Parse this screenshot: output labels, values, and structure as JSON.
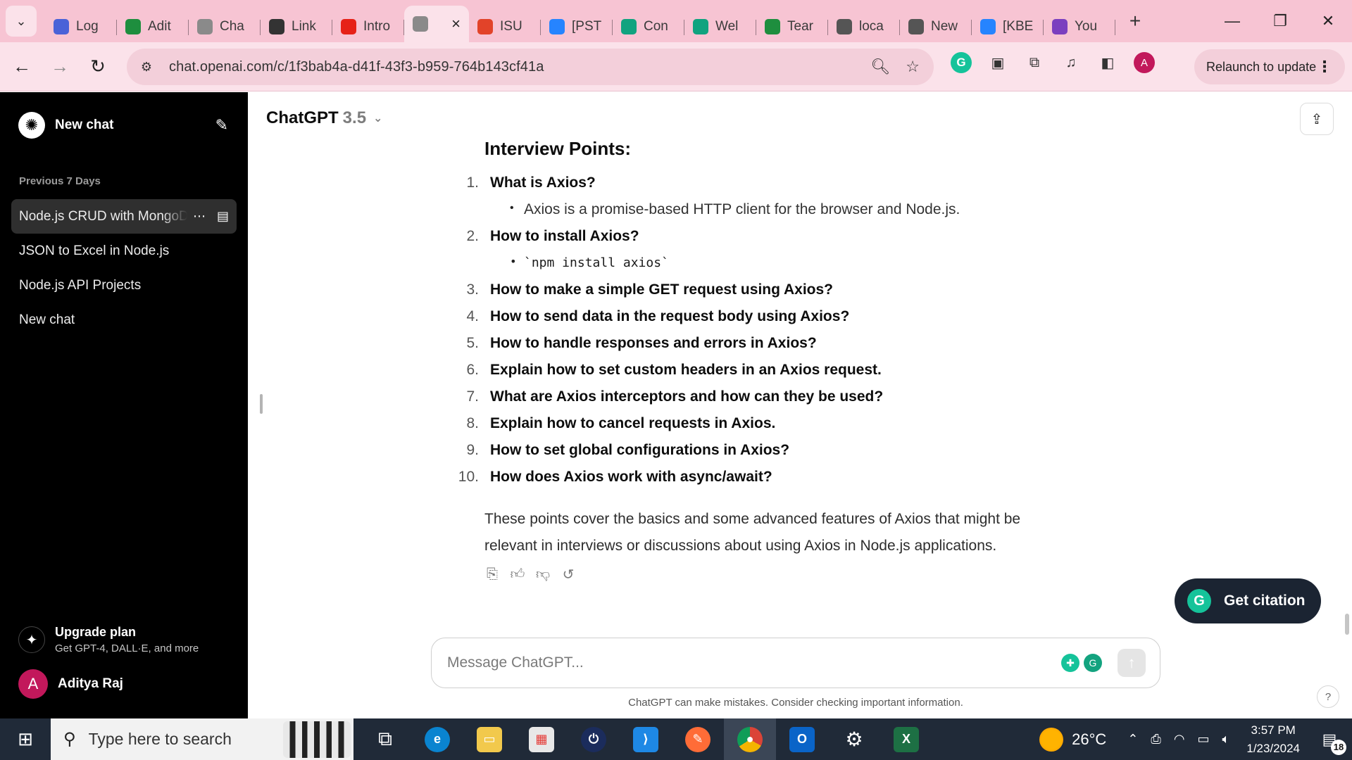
{
  "browser": {
    "tabs": [
      {
        "title": "Log",
        "icon": "powerautomate-icon",
        "color": "#4a62d8"
      },
      {
        "title": "Adit",
        "icon": "plus-square-icon",
        "color": "#1e8e3e"
      },
      {
        "title": "Cha",
        "icon": "chatgpt-icon",
        "color": "#8a8a8a"
      },
      {
        "title": "Link",
        "icon": "chevron-left-icon",
        "color": "#333333"
      },
      {
        "title": "Intro",
        "icon": "youtube-icon",
        "color": "#e62117"
      },
      {
        "title": "",
        "icon": "chatgpt-icon",
        "color": "#8a8a8a",
        "active": true
      },
      {
        "title": "ISU",
        "icon": "gitlab-icon",
        "color": "#e24329"
      },
      {
        "title": "[PST",
        "icon": "jira-icon",
        "color": "#2684ff"
      },
      {
        "title": "Con",
        "icon": "chatgpt-icon",
        "color": "#10a37f"
      },
      {
        "title": "Wel",
        "icon": "chatgpt-icon",
        "color": "#10a37f"
      },
      {
        "title": "Tear",
        "icon": "plus-square-icon",
        "color": "#1e8e3e"
      },
      {
        "title": "loca",
        "icon": "globe-icon",
        "color": "#555555"
      },
      {
        "title": "New",
        "icon": "chatgpt-icon",
        "color": "#555555"
      },
      {
        "title": "[KBE",
        "icon": "jira-icon",
        "color": "#2684ff"
      },
      {
        "title": "You",
        "icon": "forms-icon",
        "color": "#7b3fbf"
      }
    ],
    "url": "chat.openai.com/c/1f3bab4a-d41f-43f3-b959-764b143cf41a",
    "profile_initial": "A",
    "relaunch_label": "Relaunch to update"
  },
  "sidebar": {
    "new_chat_label": "New chat",
    "section_label": "Previous 7 Days",
    "items": [
      {
        "label": "Node.js CRUD with MongoDB",
        "active": true
      },
      {
        "label": "JSON to Excel in Node.js"
      },
      {
        "label": "Node.js API Projects"
      },
      {
        "label": "New chat"
      }
    ],
    "upgrade_title": "Upgrade plan",
    "upgrade_sub": "Get GPT-4, DALL·E, and more",
    "user_initial": "A",
    "user_name": "Aditya Raj"
  },
  "main": {
    "model_name": "ChatGPT",
    "model_version": "3.5",
    "heading": "Interview Points:",
    "points": [
      {
        "num": "1.",
        "text": "What is Axios?",
        "sub": "Axios is a promise-based HTTP client for the browser and Node.js."
      },
      {
        "num": "2.",
        "text": "How to install Axios?",
        "sub_code": "`npm install axios`"
      },
      {
        "num": "3.",
        "text": "How to make a simple GET request using Axios?"
      },
      {
        "num": "4.",
        "text": "How to send data in the request body using Axios?"
      },
      {
        "num": "5.",
        "text": "How to handle responses and errors in Axios?"
      },
      {
        "num": "6.",
        "text": "Explain how to set custom headers in an Axios request."
      },
      {
        "num": "7.",
        "text": "What are Axios interceptors and how can they be used?"
      },
      {
        "num": "8.",
        "text": "Explain how to cancel requests in Axios."
      },
      {
        "num": "9.",
        "text": "How to set global configurations in Axios?"
      },
      {
        "num": "10.",
        "text": "How does Axios work with async/await?"
      }
    ],
    "summary": "These points cover the basics and some advanced features of Axios that might be relevant in interviews or discussions about using Axios in Node.js applications.",
    "citation_label": "Get citation",
    "composer_placeholder": "Message ChatGPT...",
    "disclaimer": "ChatGPT can make mistakes. Consider checking important information.",
    "help_label": "?"
  },
  "taskbar": {
    "search_placeholder": "Type here to search",
    "temperature": "26°C",
    "time": "3:57 PM",
    "date": "1/23/2024",
    "notification_count": "18"
  }
}
